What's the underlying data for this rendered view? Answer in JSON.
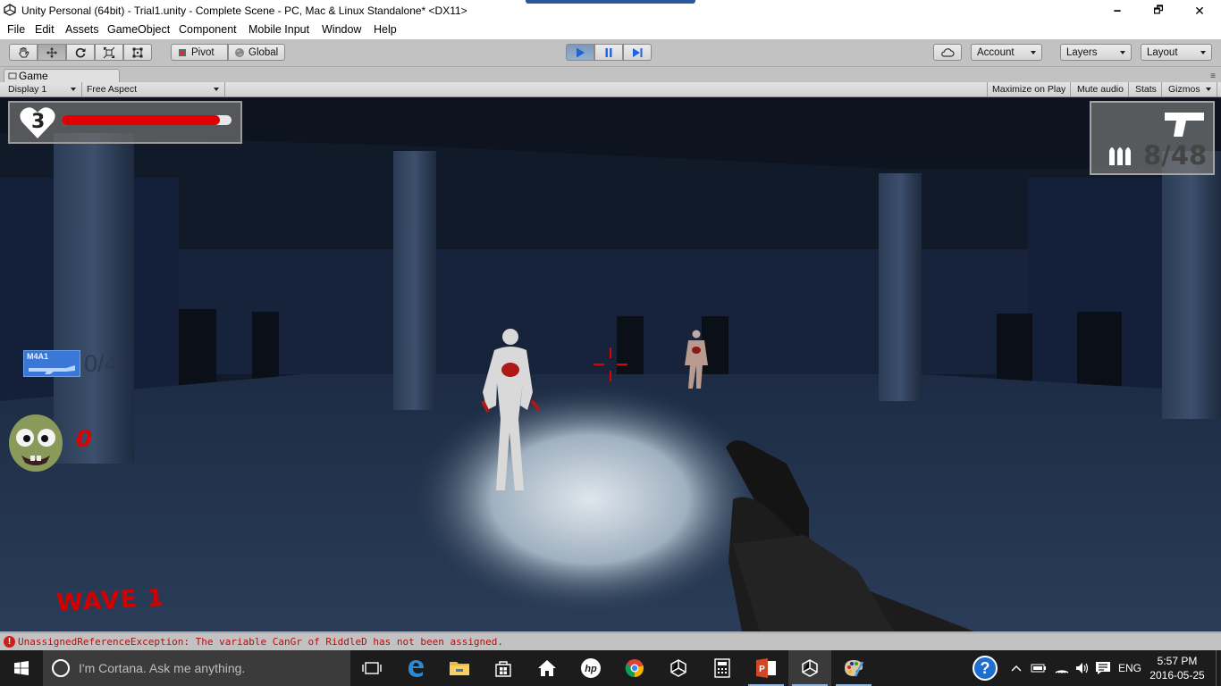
{
  "window": {
    "title": "Unity Personal (64bit) - Trial1.unity - Complete Scene - PC, Mac & Linux Standalone* <DX11>",
    "minimize": "🗕",
    "restore": "🗗",
    "close": "✕"
  },
  "menu": [
    "File",
    "Edit",
    "Assets",
    "GameObject",
    "Component",
    "Mobile Input",
    "Window",
    "Help"
  ],
  "toolbar": {
    "pivot_label": "Pivot",
    "global_label": "Global",
    "account_label": "Account",
    "layers_label": "Layers",
    "layout_label": "Layout"
  },
  "game_panel": {
    "tab_label": "Game",
    "display_label": "Display 1",
    "aspect_label": "Free Aspect",
    "maximize_label": "Maximize on Play",
    "mute_label": "Mute audio",
    "stats_label": "Stats",
    "gizmos_label": "Gizmos"
  },
  "hud": {
    "lives": "3",
    "health_fraction": 0.93,
    "ammo": "8/48",
    "weapon_name": "M4A1",
    "weapon_count": "0/4",
    "kills": "0",
    "wave": "WAVE 1",
    "health_color": "#e00000",
    "hud_red": "#d40000"
  },
  "console": {
    "error_message": "UnassignedReferenceException: The variable CanGr of RiddleD has not been assigned."
  },
  "taskbar": {
    "cortana_text": "I'm Cortana. Ask me anything.",
    "language": "ENG",
    "time": "5:57 PM",
    "date": "2016-05-25",
    "help_icon_text": "?"
  }
}
